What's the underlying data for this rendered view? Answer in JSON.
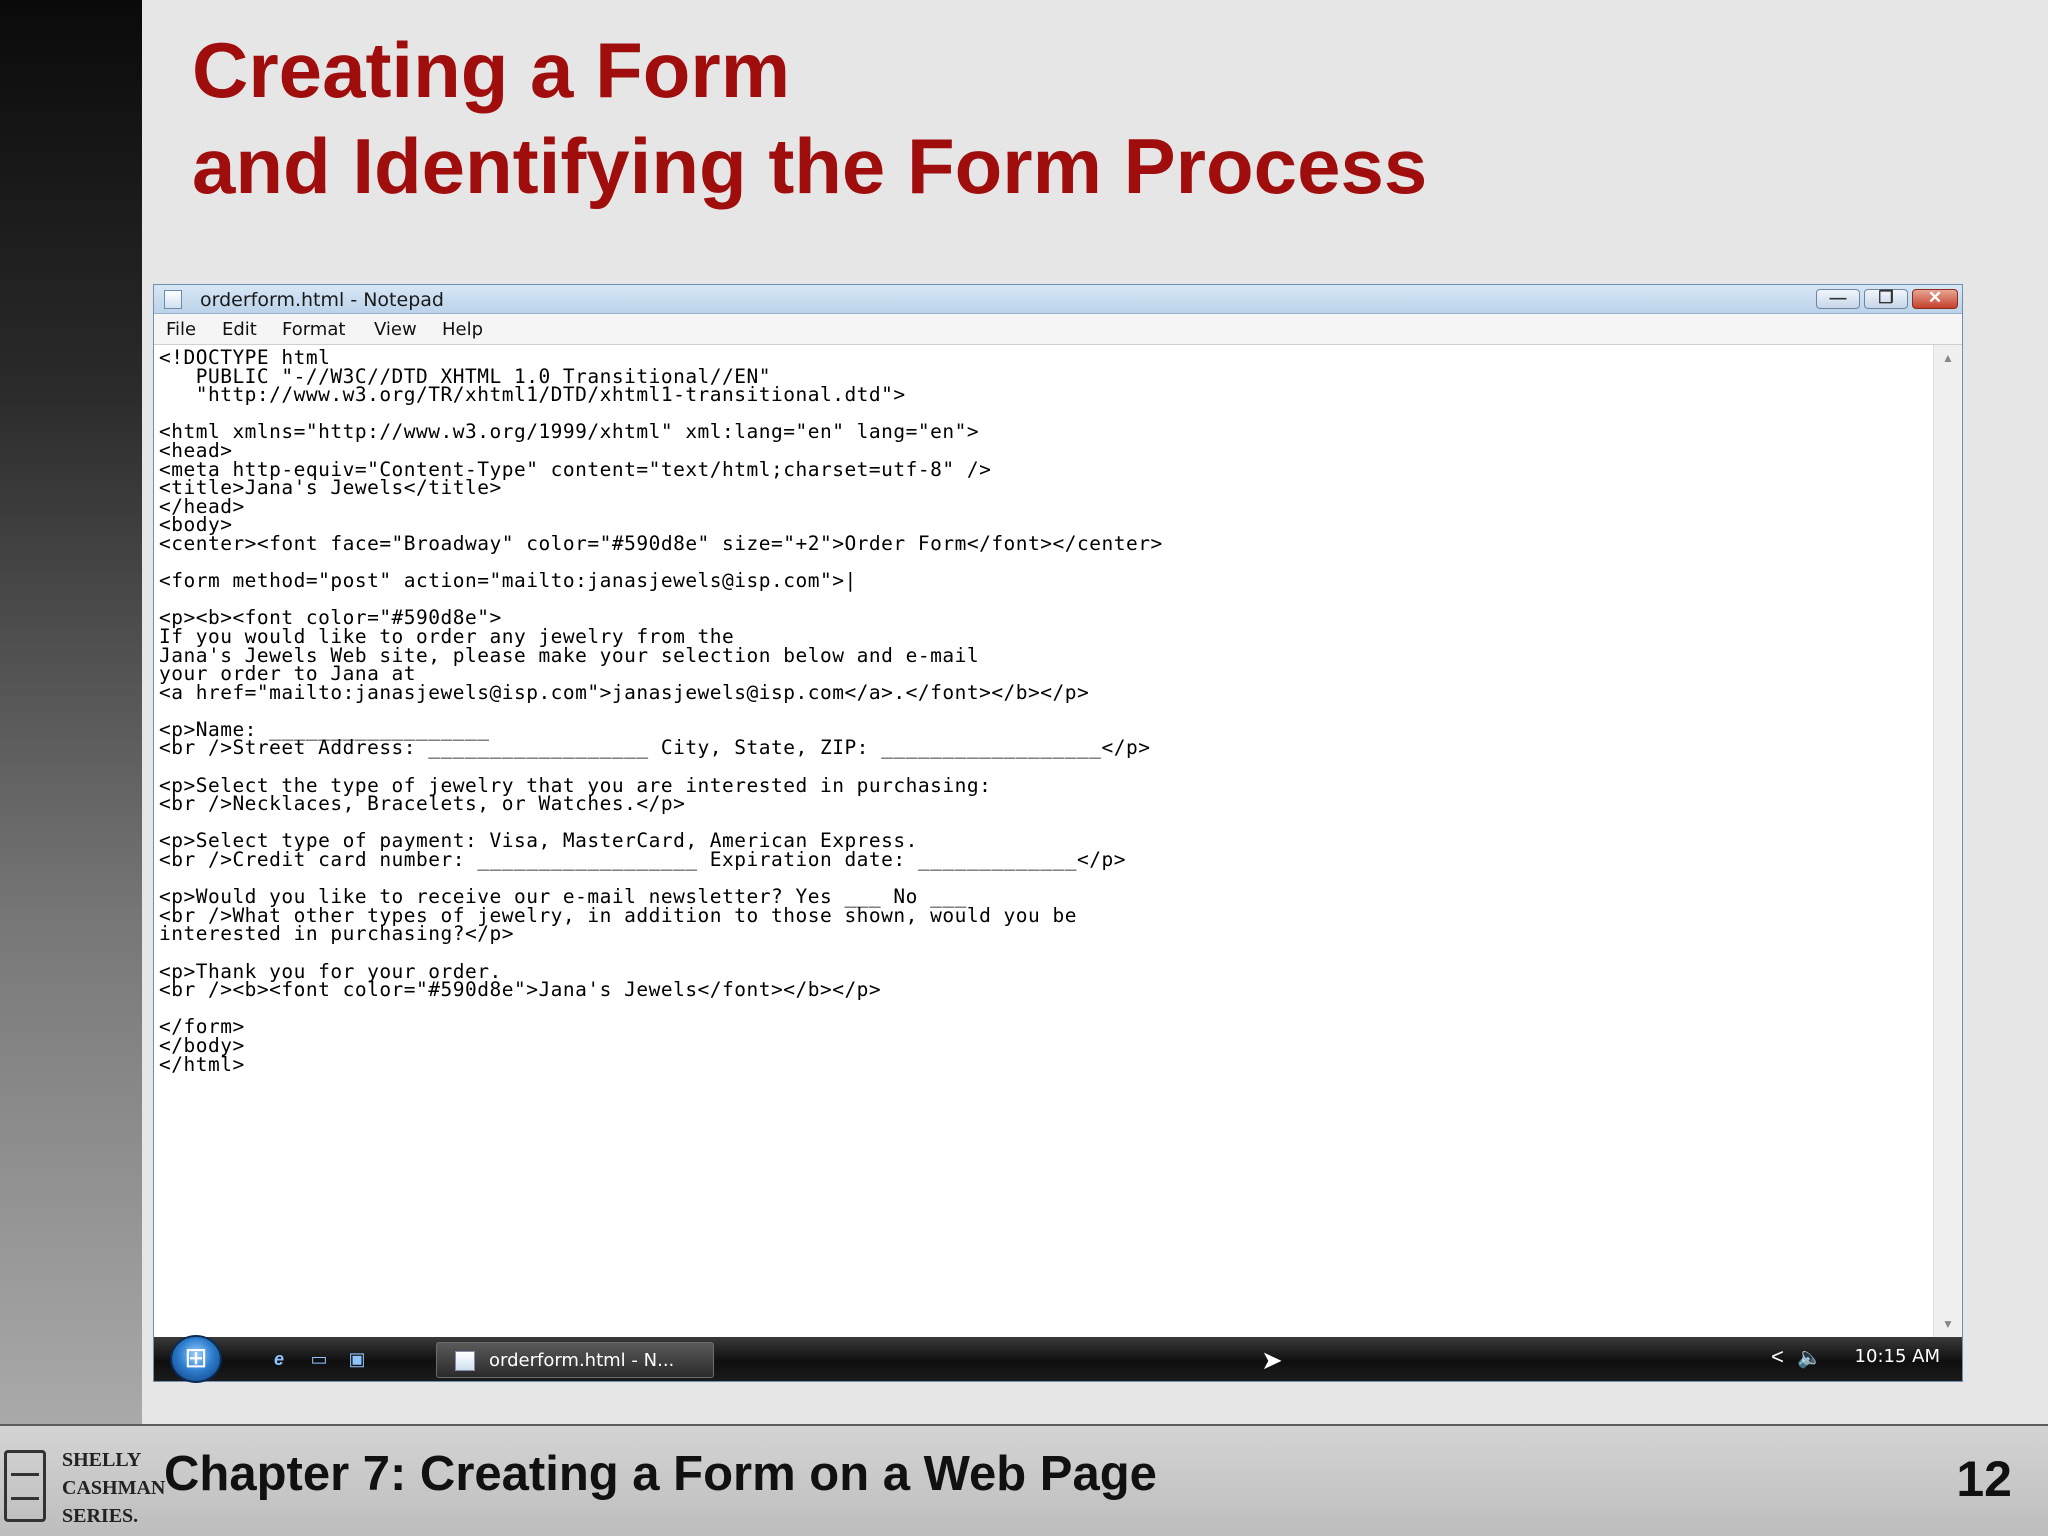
{
  "slide": {
    "title_line1": "Creating a Form",
    "title_line2": "and Identifying the Form Process",
    "footer_title": "Chapter 7: Creating a Form on a Web Page",
    "page_number": "12",
    "logo_words": [
      "SHELLY",
      "CASHMAN",
      "SERIES."
    ]
  },
  "window": {
    "title": "orderform.html - Notepad",
    "buttons": {
      "minimize": "—",
      "maximize": "❐",
      "close": "✕"
    }
  },
  "menu": [
    "File",
    "Edit",
    "Format",
    "View",
    "Help"
  ],
  "editor": {
    "content": "<!DOCTYPE html\n   PUBLIC \"-//W3C//DTD XHTML 1.0 Transitional//EN\"\n   \"http://www.w3.org/TR/xhtml1/DTD/xhtml1-transitional.dtd\">\n\n<html xmlns=\"http://www.w3.org/1999/xhtml\" xml:lang=\"en\" lang=\"en\">\n<head>\n<meta http-equiv=\"Content-Type\" content=\"text/html;charset=utf-8\" />\n<title>Jana's Jewels</title>\n</head>\n<body>\n<center><font face=\"Broadway\" color=\"#590d8e\" size=\"+2\">Order Form</font></center>\n\n<form method=\"post\" action=\"mailto:janasjewels@isp.com\">|\n\n<p><b><font color=\"#590d8e\">\nIf you would like to order any jewelry from the\nJana's Jewels Web site, please make your selection below and e-mail\nyour order to Jana at\n<a href=\"mailto:janasjewels@isp.com\">janasjewels@isp.com</a>.</font></b></p>\n\n<p>Name: __________________\n<br />Street Address: __________________ City, State, ZIP: __________________</p>\n\n<p>Select the type of jewelry that you are interested in purchasing:\n<br />Necklaces, Bracelets, or Watches.</p>\n\n<p>Select type of payment: Visa, MasterCard, American Express.\n<br />Credit card number: __________________ Expiration date: _____________</p>\n\n<p>Would you like to receive our e-mail newsletter? Yes ___ No ___\n<br />What other types of jewelry, in addition to those shown, would you be\ninterested in purchasing?</p>\n\n<p>Thank you for your order.\n<br /><b><font color=\"#590d8e\">Jana's Jewels</font></b></p>\n\n</form>\n</body>\n</html>"
  },
  "taskbar": {
    "task_label": "orderform.html - N...",
    "clock": "10:15 AM",
    "tray_chevron": "<",
    "volume": "🔈"
  },
  "icons": {
    "start": "⊞",
    "ie": "e",
    "desktop": "▭",
    "switch_windows": "▣",
    "cursor": "➤",
    "scroll_up": "▲",
    "scroll_down": "▼"
  },
  "colors": {
    "title_red": "#a00d0d"
  }
}
